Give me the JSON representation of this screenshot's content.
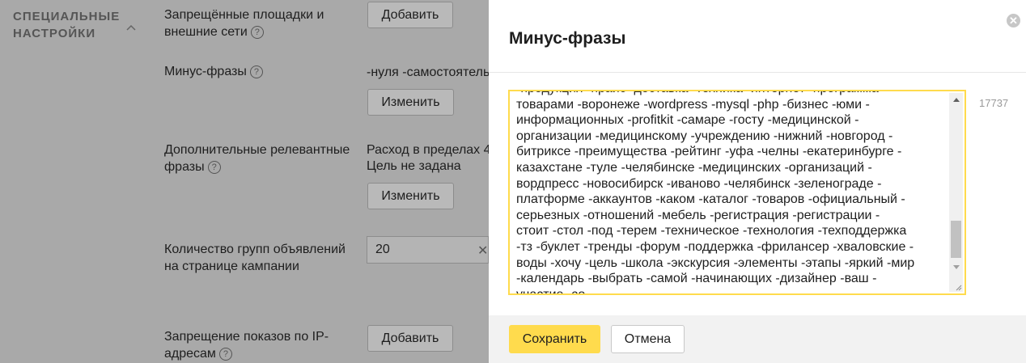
{
  "settings": {
    "section_title": "СПЕЦИАЛЬНЫЕ НАСТРОЙКИ",
    "blocked_sites": {
      "label": "Запрещённые площадки и внешние сети",
      "button": "Добавить"
    },
    "negative_phrases": {
      "label": "Минус-фразы",
      "value": "-нуля -самостоятель",
      "button": "Изменить"
    },
    "extra_phrases": {
      "label": "Дополнительные релевантные фразы",
      "value_line1": "Расход в пределах 4",
      "value_line2": "Цель не задана",
      "button": "Изменить"
    },
    "groups_per_page": {
      "label": "Количество групп объявлений на странице кампании",
      "value": "20"
    },
    "ip_block": {
      "label": "Запрещение показов по IP-адресам",
      "button": "Добавить"
    }
  },
  "modal": {
    "title": "Минус-фразы",
    "char_counter": "17737",
    "textarea_lines": [
      "-продукция -прайс -доставка -техника -интернет -программа -",
      "товарами -воронеже -wordpress -mysql -php -бизнес -юми -",
      "информационных -profitkit -самаре -госту -медицинской -",
      "организации -медицинскому -учреждению -нижний -новгород -",
      "битриксе -преимущества -рейтинг -уфа -челны -екатеринбурге -",
      "казахстане -туле -челябинске -медицинских -организаций -",
      "вордпресс -новосибирск -иваново -челябинск -зеленограде -",
      "платформе -аккаунтов -каком -каталог -товаров -официальный -",
      "серьезных -отношений -мебель -регистрация -регистрации -",
      "стоит -стол -под -терем -техническое -технология -техподдержка",
      "-тз -буклет -тренды -форум -поддержка -фрилансер -хваловские -",
      "воды -хочу -цель -школа -экскурсия -элементы -этапы -яркий -мир",
      "-календарь -выбрать -самой -начинающих -дизайнер -ваш -",
      "участие -со"
    ],
    "save_label": "Сохранить",
    "cancel_label": "Отмена"
  },
  "colors": {
    "accent": "#ffdb4d",
    "overlay": "#a9a9a9"
  }
}
